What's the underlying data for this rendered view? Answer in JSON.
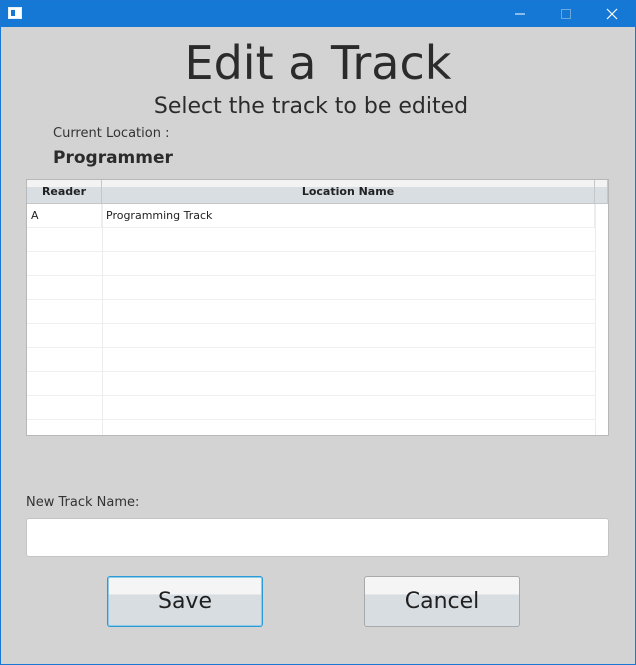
{
  "window": {
    "title_icon": "app-window-icon",
    "controls": [
      "minimize-icon",
      "maximize-icon",
      "close-icon"
    ],
    "accent_color": "#1578d5"
  },
  "header": {
    "title": "Edit a Track",
    "subtitle": "Select the track to be edited"
  },
  "current_location": {
    "label": "Current Location :",
    "value": "Programmer"
  },
  "table": {
    "columns": [
      "Reader",
      "Location Name"
    ],
    "rows": [
      {
        "reader": "A",
        "location_name": "Programming Track"
      }
    ]
  },
  "new_track": {
    "label": "New Track Name:",
    "value": "",
    "placeholder": ""
  },
  "actions": {
    "save_label": "Save",
    "cancel_label": "Cancel"
  }
}
